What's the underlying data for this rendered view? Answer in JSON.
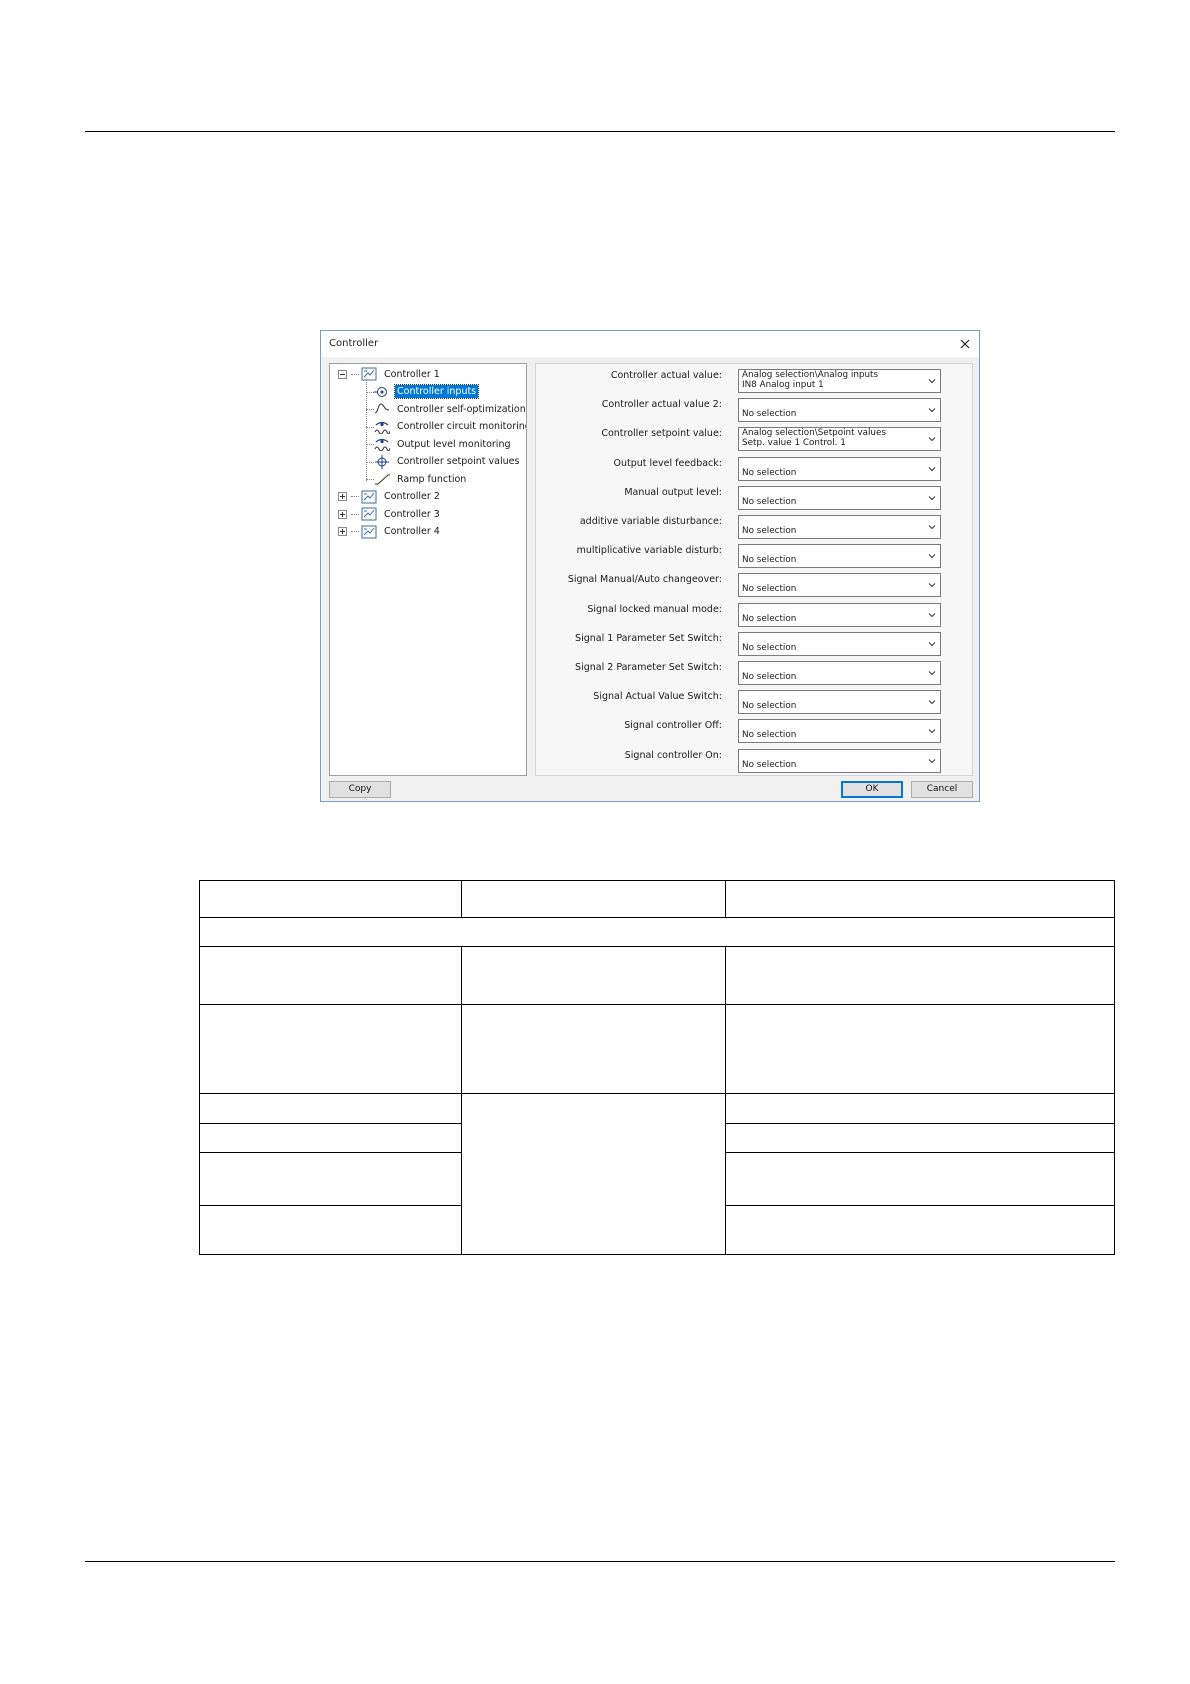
{
  "dialog": {
    "title": "Controller",
    "tree": [
      {
        "label": "Controller 1",
        "level": 0,
        "expanded": true,
        "icon": "controller-icon"
      },
      {
        "label": "Controller inputs",
        "level": 1,
        "selected": true,
        "icon": "input-icon"
      },
      {
        "label": "Controller self-optimization",
        "level": 1,
        "icon": "optimization-curve-icon"
      },
      {
        "label": "Controller circuit monitoring",
        "level": 1,
        "icon": "monitoring-eye-icon"
      },
      {
        "label": "Output level monitoring",
        "level": 1,
        "icon": "monitoring-eye-icon"
      },
      {
        "label": "Controller setpoint values",
        "level": 1,
        "icon": "setpoint-target-icon"
      },
      {
        "label": "Ramp function",
        "level": 1,
        "icon": "ramp-icon"
      },
      {
        "label": "Controller 2",
        "level": 0,
        "expanded": false,
        "icon": "controller-icon"
      },
      {
        "label": "Controller 3",
        "level": 0,
        "expanded": false,
        "icon": "controller-icon"
      },
      {
        "label": "Controller 4",
        "level": 0,
        "expanded": false,
        "icon": "controller-icon"
      }
    ],
    "fields": [
      {
        "label": "Controller actual value:",
        "value": [
          "Analog selection\\Analog inputs",
          "IN8 Analog input 1"
        ]
      },
      {
        "label": "Controller actual value 2:",
        "value": [
          "No selection"
        ]
      },
      {
        "label": "Controller setpoint value:",
        "value": [
          "Analog selection\\Setpoint values",
          "Setp. value 1 Control. 1"
        ]
      },
      {
        "label": "Output level feedback:",
        "value": [
          "No selection"
        ]
      },
      {
        "label": "Manual output level:",
        "value": [
          "No selection"
        ]
      },
      {
        "label": "additive variable disturbance:",
        "value": [
          "No selection"
        ]
      },
      {
        "label": "multiplicative variable disturb:",
        "value": [
          "No selection"
        ]
      },
      {
        "label": "Signal  Manual/Auto changeover:",
        "value": [
          "No selection"
        ]
      },
      {
        "label": "Signal locked manual mode:",
        "value": [
          "No selection"
        ]
      },
      {
        "label": "Signal 1 Parameter Set Switch:",
        "value": [
          "No selection"
        ]
      },
      {
        "label": "Signal 2 Parameter Set Switch:",
        "value": [
          "No selection"
        ]
      },
      {
        "label": "Signal Actual Value Switch:",
        "value": [
          "No selection"
        ]
      },
      {
        "label": "Signal controller Off:",
        "value": [
          "No selection"
        ]
      },
      {
        "label": "Signal controller On:",
        "value": [
          "No selection"
        ]
      }
    ],
    "buttons": {
      "copy": "Copy",
      "ok": "OK",
      "cancel": "Cancel"
    }
  },
  "colors": {
    "selection": "#0078d7",
    "dialog_border": "#7a9cc6",
    "panel_bg": "#f0f0f0"
  }
}
